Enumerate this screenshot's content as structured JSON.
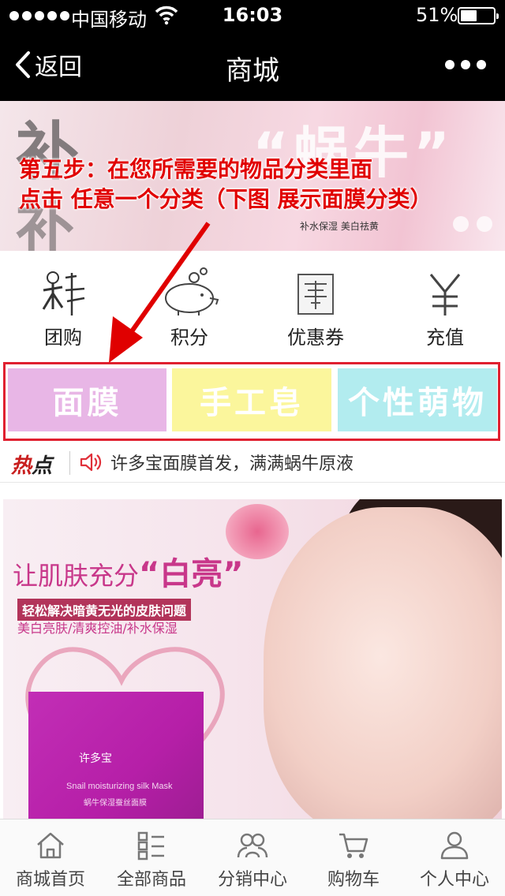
{
  "status_bar": {
    "carrier": "中国移动",
    "time": "16:03",
    "battery": "51%",
    "battery_level": 0.51
  },
  "nav": {
    "back_label": "返回",
    "title": "商城"
  },
  "banner": {
    "ghost_left": "补",
    "ghost_right": "“蜗牛”",
    "ghost_bottom": "补",
    "subtitle": "补水保湿  美白祛黄"
  },
  "overlay_note": {
    "line1": "第五步：在您所需要的物品分类里面",
    "line2": "点击 任意一个分类（下图 展示面膜分类）"
  },
  "quick_links": [
    {
      "label": "团购",
      "icon": "group-buy-icon"
    },
    {
      "label": "积分",
      "icon": "piggy-bank-icon"
    },
    {
      "label": "优惠券",
      "icon": "coupon-icon"
    },
    {
      "label": "充值",
      "icon": "yuan-icon"
    }
  ],
  "categories": [
    {
      "label": "面膜",
      "color": "#e8b6e6"
    },
    {
      "label": "手工皂",
      "color": "#fbf69c"
    },
    {
      "label": "个性萌物",
      "color": "#b2ecef"
    }
  ],
  "hot": {
    "label_red": "热",
    "label_dark": "点",
    "text": "许多宝面膜首发，满满蜗牛原液"
  },
  "product": {
    "slogan": "让肌肤充分",
    "slogan_highlight": "“白亮”",
    "tag": "轻松解决暗黄无光的皮肤问题",
    "benefits": "美白亮肤/清爽控油/补水保湿",
    "brand": "许多宝",
    "package_english": "Snail moisturizing silk Mask",
    "package_chinese": "蜗牛保湿蚕丝面膜"
  },
  "tabbar": [
    {
      "label": "商城首页",
      "icon": "home-icon"
    },
    {
      "label": "全部商品",
      "icon": "grid-list-icon"
    },
    {
      "label": "分销中心",
      "icon": "people-icon"
    },
    {
      "label": "购物车",
      "icon": "cart-icon"
    },
    {
      "label": "个人中心",
      "icon": "person-icon"
    }
  ],
  "colors": {
    "accent_red": "#e10000",
    "frame_red": "#e02030"
  }
}
